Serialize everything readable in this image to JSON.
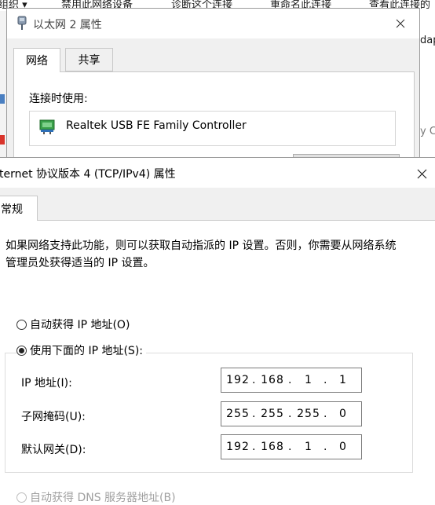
{
  "background": {
    "toolbar_items": [
      "组织 ▾",
      "禁用此网络设备",
      "诊断这个连接",
      "重命名此连接",
      "查看此连接的"
    ],
    "side_right_top": "dapt",
    "side_right_mid": "y C"
  },
  "eth_window": {
    "title": "以太网 2 属性",
    "tabs": [
      "网络",
      "共享"
    ],
    "connect_label": "连接时使用:",
    "adapter_name": "Realtek USB FE Family Controller"
  },
  "ipv4_window": {
    "title": "ternet 协议版本 4 (TCP/IPv4) 属性",
    "tab": "常规",
    "description": "如果网络支持此功能，则可以获取自动指派的 IP 设置。否则，你需要从网络系统管理员处获得适当的 IP 设置。",
    "auto_ip_label": "自动获得 IP 地址(O)",
    "use_ip_label": "使用下面的 IP 地址(S):",
    "fields": [
      {
        "label": "IP 地址(I):",
        "value": [
          "192",
          "168",
          "1",
          "1"
        ]
      },
      {
        "label": "子网掩码(U):",
        "value": [
          "255",
          "255",
          "255",
          "0"
        ]
      },
      {
        "label": "默认网关(D):",
        "value": [
          "192",
          "168",
          "1",
          "0"
        ]
      }
    ],
    "auto_dns_label": "自动获得 DNS 服务器地址(B)"
  },
  "colors": {
    "window_bg": "#f0f0f0",
    "border": "#9a9a9a",
    "disabled_text": "#a0a0a0"
  }
}
